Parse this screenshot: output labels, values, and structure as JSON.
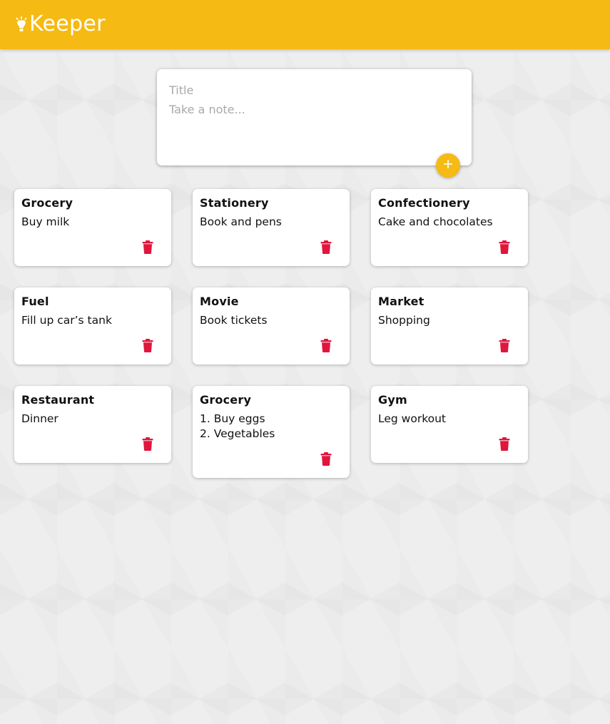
{
  "header": {
    "app_name": "Keeper",
    "brand_color": "#f5ba13",
    "logo_icon": "lightbulb-icon"
  },
  "composer": {
    "title_placeholder": "Title",
    "content_placeholder": "Take a note...",
    "add_icon": "plus-icon"
  },
  "notes": [
    {
      "title": "Grocery",
      "content": "Buy milk"
    },
    {
      "title": "Stationery",
      "content": "Book and pens"
    },
    {
      "title": "Confectionery",
      "content": "Cake and chocolates"
    },
    {
      "title": "Fuel",
      "content": "Fill up car’s tank"
    },
    {
      "title": "Movie",
      "content": "Book tickets"
    },
    {
      "title": "Market",
      "content": "Shopping"
    },
    {
      "title": "Restaurant",
      "content": "Dinner"
    },
    {
      "title": "Grocery",
      "content": "1. Buy eggs\n2. Vegetables"
    },
    {
      "title": "Gym",
      "content": "Leg workout"
    }
  ],
  "delete_icon": "trash-icon",
  "delete_color": "#e0163d"
}
